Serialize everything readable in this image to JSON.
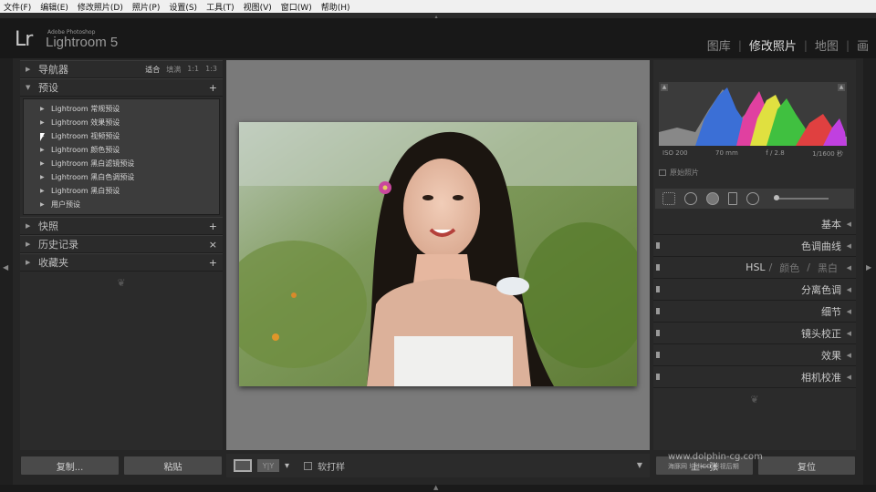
{
  "menu": [
    "文件(F)",
    "编辑(E)",
    "修改照片(D)",
    "照片(P)",
    "设置(S)",
    "工具(T)",
    "视图(V)",
    "窗口(W)",
    "帮助(H)"
  ],
  "app": {
    "logo": "Lr",
    "adobe": "Adobe Photoshop",
    "name": "Lightroom 5"
  },
  "modules": [
    {
      "label": "图库",
      "active": false
    },
    {
      "label": "修改照片",
      "active": true
    },
    {
      "label": "地图",
      "active": false
    },
    {
      "label": "画",
      "active": false
    }
  ],
  "left": {
    "navigator": {
      "title": "导航器",
      "opts": [
        "适合",
        "填满",
        "1:1",
        "1:3"
      ],
      "selected": "适合"
    },
    "presets": {
      "title": "预设",
      "action": "+",
      "items": [
        "Lightroom 常规预设",
        "Lightroom 效果预设",
        "Lightroom 视频预设",
        "Lightroom 颜色预设",
        "Lightroom 黑白滤镜预设",
        "Lightroom 黑白色调预设",
        "Lightroom 黑白预设",
        "用户预设"
      ]
    },
    "snapshots": {
      "title": "快照",
      "action": "+"
    },
    "history": {
      "title": "历史记录",
      "action": "×"
    },
    "collections": {
      "title": "收藏夹",
      "action": "+"
    },
    "buttons": {
      "copy": "复制...",
      "paste": "粘贴"
    }
  },
  "toolbar": {
    "yy": "Y|Y",
    "softproof": "软打样"
  },
  "right": {
    "hist_info": {
      "iso": "ISO 200",
      "focal": "70 mm",
      "aperture": "f / 2.8",
      "shutter": "1/1600 秒"
    },
    "original": "原始照片",
    "sections": [
      "基本",
      "色调曲线",
      "HSL",
      "颜色",
      "黑白",
      "分离色调",
      "细节",
      "镜头校正",
      "效果",
      "相机校准"
    ],
    "buttons": {
      "prev": "上一张",
      "reset": "复位"
    }
  },
  "watermark": {
    "line1": "www.dolphin-cg.com",
    "line2": "海豚网 培训CG 影视后期"
  },
  "colors": {
    "accent": "#dedede",
    "panel": "#2b2b2b",
    "canvas": "#7a7a7a"
  }
}
